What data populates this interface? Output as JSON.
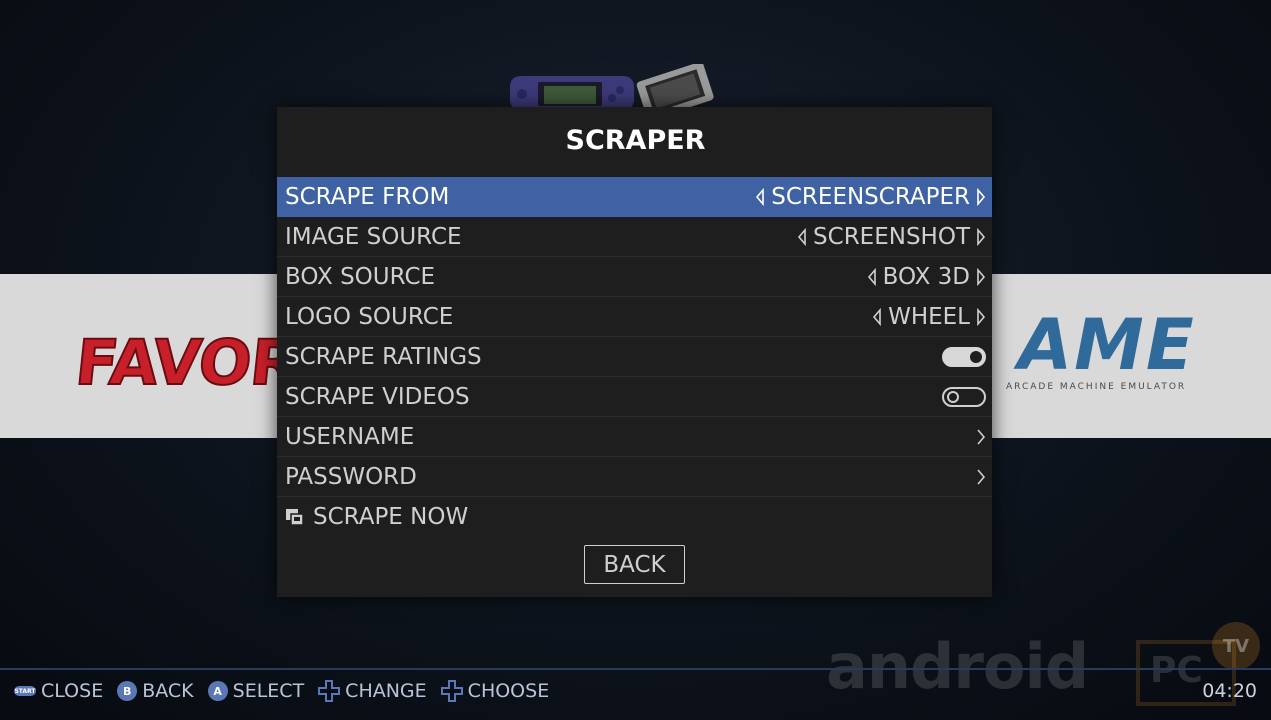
{
  "dialog": {
    "title": "SCRAPER",
    "rows": [
      {
        "label": "SCRAPE FROM",
        "value": "SCREENSCRAPER",
        "type": "select",
        "selected": true
      },
      {
        "label": "IMAGE SOURCE",
        "value": "SCREENSHOT",
        "type": "select"
      },
      {
        "label": "BOX SOURCE",
        "value": "BOX 3D",
        "type": "select"
      },
      {
        "label": "LOGO SOURCE",
        "value": "WHEEL",
        "type": "select"
      },
      {
        "label": "SCRAPE RATINGS",
        "type": "toggle",
        "on": true
      },
      {
        "label": "SCRAPE VIDEOS",
        "type": "toggle",
        "on": false
      },
      {
        "label": "USERNAME",
        "type": "submenu"
      },
      {
        "label": "PASSWORD",
        "type": "submenu"
      },
      {
        "label": "SCRAPE NOW",
        "type": "action",
        "icon": "scrape-icon"
      }
    ],
    "back_label": "BACK"
  },
  "background": {
    "left_logo": "FAVORIT",
    "right_logo": "AME",
    "right_logo_sub": "ARCADE MACHINE EMULATOR"
  },
  "helpbar": {
    "items": [
      {
        "icon": "START",
        "label": "CLOSE"
      },
      {
        "icon": "B",
        "label": "BACK"
      },
      {
        "icon": "A",
        "label": "SELECT"
      },
      {
        "icon": "dpad-icon",
        "label": "CHANGE"
      },
      {
        "icon": "dpad-icon",
        "label": "CHOOSE"
      }
    ],
    "clock": "04:20"
  },
  "watermark": {
    "text": "android",
    "box_text": "PC",
    "badge": "TV"
  },
  "colors": {
    "selection": "#3e62a4",
    "dialog_bg": "#1e1e1e",
    "help_icon": "#5a77b6"
  }
}
